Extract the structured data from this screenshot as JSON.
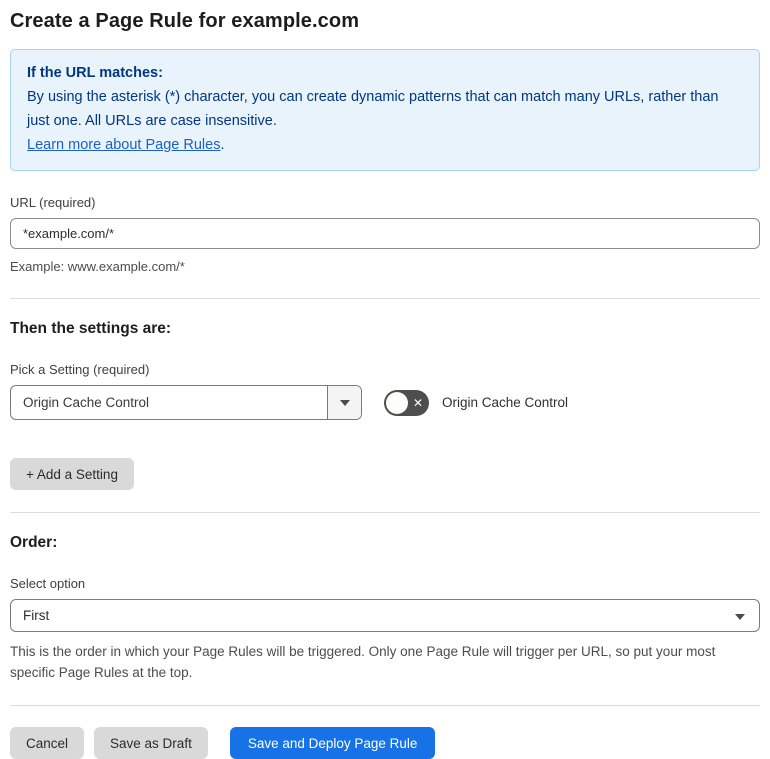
{
  "page": {
    "title": "Create a Page Rule for example.com"
  },
  "info_box": {
    "heading": "If the URL matches:",
    "body": "By using the asterisk (*) character, you can create dynamic patterns that can match many URLs, rather than just one. All URLs are case insensitive.",
    "link_label": "Learn more about Page Rules",
    "link_suffix": "."
  },
  "url_field": {
    "label": "URL (required)",
    "value": "*example.com/*",
    "helper": "Example: www.example.com/*"
  },
  "settings_section": {
    "heading": "Then the settings are:",
    "picker_label": "Pick a Setting (required)",
    "picker_value": "Origin Cache Control",
    "toggle_label": "Origin Cache Control",
    "toggle_state": "off",
    "toggle_off_glyph": "✕",
    "add_button_label": "+ Add a Setting"
  },
  "order_section": {
    "heading": "Order:",
    "select_label": "Select option",
    "select_value": "First",
    "helper": "This is the order in which your Page Rules will be triggered. Only one Page Rule will trigger per URL, so put your most specific Page Rules at the top."
  },
  "footer": {
    "cancel_label": "Cancel",
    "save_draft_label": "Save as Draft",
    "save_deploy_label": "Save and Deploy Page Rule"
  },
  "colors": {
    "accent_blue": "#1672e6",
    "info_bg": "#e9f3fc",
    "info_border": "#a9d3f5",
    "info_text": "#003682",
    "link_blue": "#1b5fc8",
    "toggle_off_bg": "#4e4e4e",
    "button_gray": "#d9d9d9",
    "divider_gray": "#dcdcdc"
  }
}
